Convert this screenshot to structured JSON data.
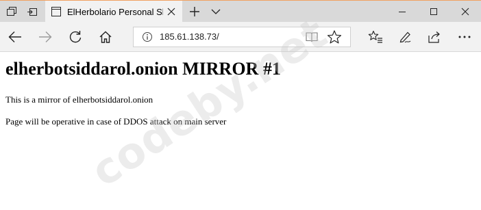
{
  "tab": {
    "title": "ElHerbolario Personal Sl"
  },
  "address_bar": {
    "url": "185.61.138.73/"
  },
  "page": {
    "heading": "elherbotsiddarol.onion MIRROR #1",
    "paragraph1": "This is a mirror of elherbotsiddarol.onion",
    "paragraph2": "Page will be operative in case of DDOS attack on main server"
  },
  "watermark": {
    "text": "codeby.net"
  },
  "icons": {
    "tab_actions": [
      "tab-preview-icon",
      "set-aside-tabs-icon"
    ],
    "tab_favicon": "page-icon",
    "new_tab": "plus-icon",
    "tab_list": "chevron-down-icon",
    "window": [
      "minimize-icon",
      "maximize-icon",
      "close-icon"
    ],
    "nav": [
      "back-arrow-icon",
      "forward-arrow-icon",
      "refresh-icon",
      "home-icon"
    ],
    "address": [
      "info-icon",
      "reading-view-icon",
      "favorite-star-icon"
    ],
    "toolbar": [
      "favorites-hub-icon",
      "web-note-icon",
      "share-icon",
      "more-icon"
    ]
  },
  "colors": {
    "tabbar_bg": "#d9d9d9",
    "toolbar_bg": "#f2f2f2",
    "window_accent": "#f0a060"
  }
}
